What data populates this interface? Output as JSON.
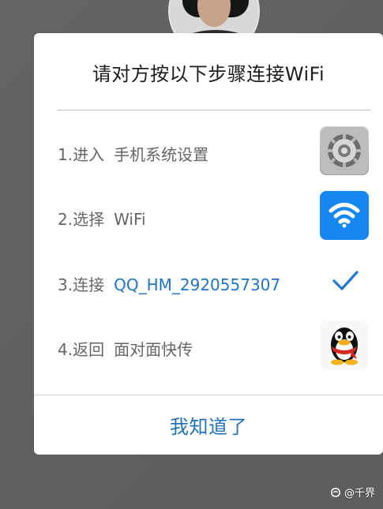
{
  "dialog": {
    "title": "请对方按以下步骤连接WiFi",
    "steps": [
      {
        "label": "1.进入",
        "value": "手机系统设置",
        "icon": "settings-icon"
      },
      {
        "label": "2.选择",
        "value": "WiFi",
        "icon": "wifi-icon"
      },
      {
        "label": "3.连接",
        "value": "QQ_HM_2920557307",
        "icon": "check-icon"
      },
      {
        "label": "4.返回",
        "value": "面对面快传",
        "icon": "qq-penguin-icon"
      }
    ],
    "confirm_button": "我知道了"
  },
  "watermark": {
    "text": "@千界",
    "icon": "watermark-logo-icon"
  },
  "colors": {
    "background": "#5f5f61",
    "dialog": "#ffffff",
    "accent": "#1f72bf",
    "wifi_blue": "#1687f0"
  }
}
